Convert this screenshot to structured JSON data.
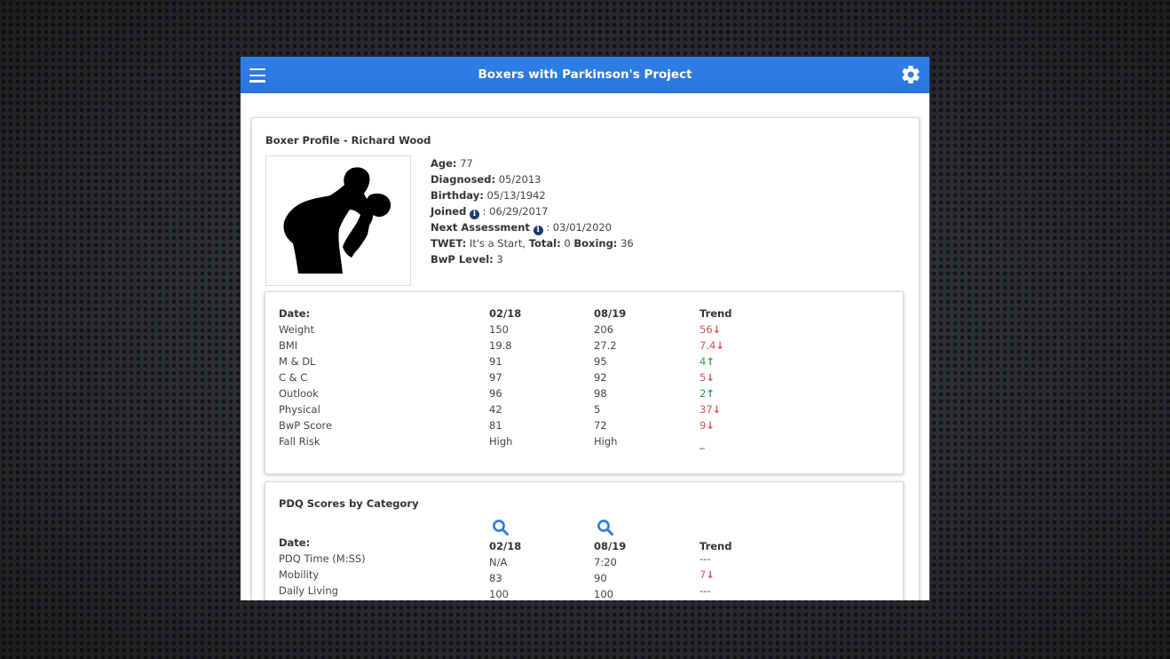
{
  "header": {
    "title": "Boxers with Parkinson's Project"
  },
  "profile": {
    "title": "Boxer Profile - Richard Wood",
    "age_label": "Age:",
    "age": "77",
    "diagnosed_label": "Diagnosed:",
    "diagnosed": "05/2013",
    "birthday_label": "Birthday:",
    "birthday": "05/13/1942",
    "joined_label": "Joined",
    "joined": ": 06/29/2017",
    "next_label": "Next Assessment",
    "next": ": 03/01/2020",
    "twet_label": "TWET:",
    "twet": "It's a Start,",
    "total_label": "Total:",
    "total": "0",
    "boxing_label": "Boxing:",
    "boxing": "36",
    "level_label": "BwP Level:",
    "level": "3"
  },
  "stats": {
    "headers": [
      "Date:",
      "02/18",
      "08/19",
      "Trend"
    ],
    "rows": [
      {
        "label": "Weight",
        "a": "150",
        "b": "206",
        "trend": "56",
        "dir": "down"
      },
      {
        "label": "BMI",
        "a": "19.8",
        "b": "27.2",
        "trend": "7.4",
        "dir": "down"
      },
      {
        "label": "M & DL",
        "a": "91",
        "b": "95",
        "trend": "4",
        "dir": "up"
      },
      {
        "label": "C & C",
        "a": "97",
        "b": "92",
        "trend": "5",
        "dir": "down"
      },
      {
        "label": "Outlook",
        "a": "96",
        "b": "98",
        "trend": "2",
        "dir": "up"
      },
      {
        "label": "Physical",
        "a": "42",
        "b": "5",
        "trend": "37",
        "dir": "down"
      },
      {
        "label": "BwP Score",
        "a": "81",
        "b": "72",
        "trend": "9",
        "dir": "down"
      },
      {
        "label": "Fall Risk",
        "a": "High",
        "b": "High",
        "trend": "_",
        "dir": "none"
      }
    ]
  },
  "pdq": {
    "title": "PDQ Scores by Category",
    "headers": [
      "Date:",
      "02/18",
      "08/19",
      "Trend"
    ],
    "rows": [
      {
        "label": "PDQ Time (M:SS)",
        "a": "N/A",
        "b": "7:20",
        "trend": "---",
        "dir": "none"
      },
      {
        "label": "Mobility",
        "a": "83",
        "b": "90",
        "trend": "7",
        "dir": "down"
      },
      {
        "label": "Daily Living",
        "a": "100",
        "b": "100",
        "trend": "---",
        "dir": "none"
      }
    ]
  },
  "colors": {
    "header_bg": "#2c7be5",
    "trend_down": "#d9534f",
    "trend_up": "#28a745",
    "info_icon": "#1f3b6e",
    "zoom_icon": "#2c7be5"
  },
  "icons": {
    "menu": "hamburger-menu-icon",
    "settings": "gear-icon",
    "info": "info-circle-icon",
    "zoom": "magnifier-icon",
    "up": "arrow-up-icon",
    "down": "arrow-down-icon"
  }
}
